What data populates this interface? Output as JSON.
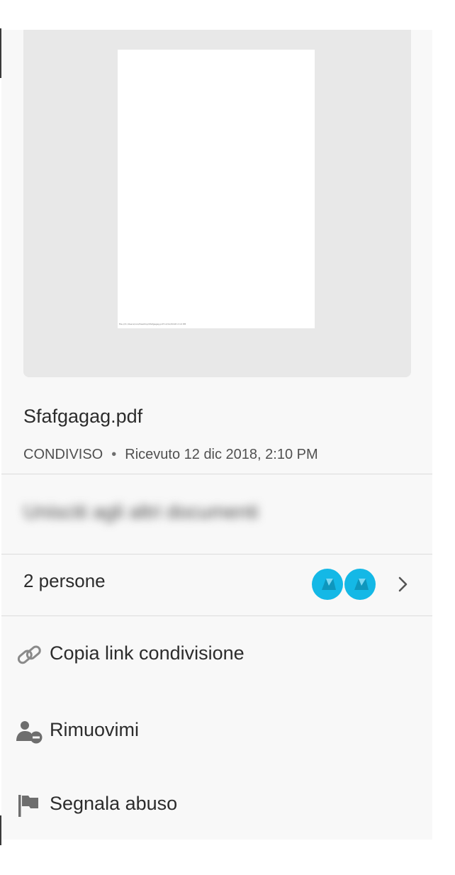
{
  "document": {
    "file_name": "Sfafgagag.pdf",
    "status": "CONDIVISO",
    "separator": "•",
    "received": "Ricevuto 12 dic 2018, 2:10 PM",
    "thumbnail_footer": "file:///C:/Users/xxx/Desktop/Sfafgagag.pdf 12/12/2018 2:10 PM"
  },
  "redacted_message": "Unisciti agli altri documenti",
  "participants": {
    "label": "2 persone",
    "avatar_color": "#14b8e6",
    "avatars": [
      "user-avatar-1",
      "user-avatar-2"
    ],
    "chevron": "chevron-right-icon"
  },
  "actions": [
    {
      "id": "copy-link",
      "label": "Copia link condivisione",
      "icon": "link-icon"
    },
    {
      "id": "remove-me",
      "label": "Rimuovimi",
      "icon": "remove-user-icon"
    },
    {
      "id": "report-abuse",
      "label": "Segnala abuso",
      "icon": "flag-icon"
    }
  ]
}
